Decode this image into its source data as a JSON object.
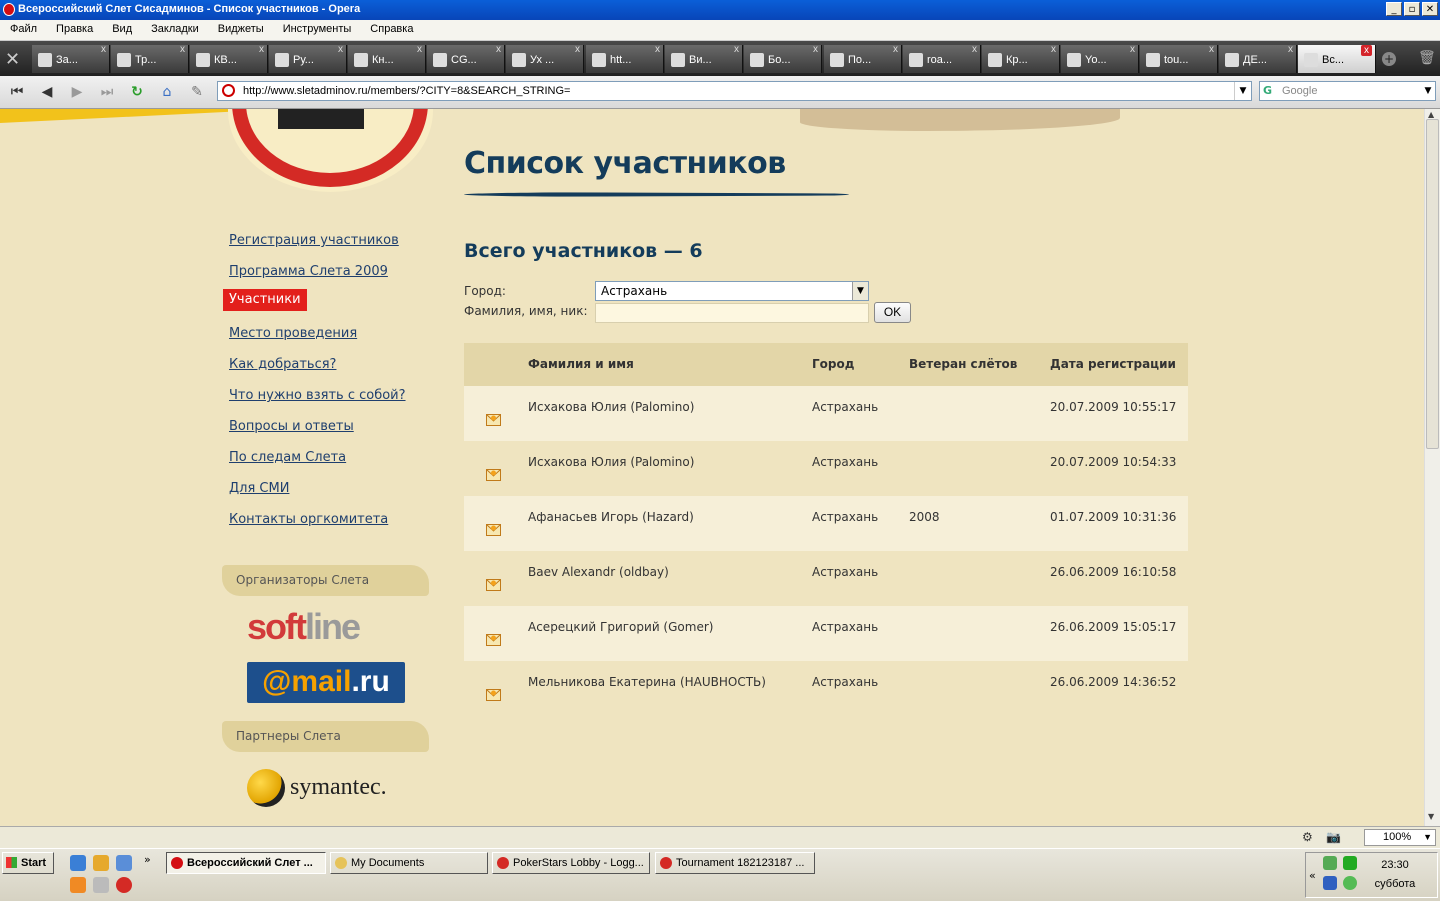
{
  "window": {
    "title": "Всероссийский Слет Сисадминов - Список участников - Opera"
  },
  "menu": [
    "Файл",
    "Правка",
    "Вид",
    "Закладки",
    "Виджеты",
    "Инструменты",
    "Справка"
  ],
  "tabs": [
    {
      "label": "За...",
      "icon": "wrench-icon"
    },
    {
      "label": "Тр...",
      "icon": "percent-icon"
    },
    {
      "label": "КВ...",
      "icon": "globe-icon"
    },
    {
      "label": "Ру...",
      "icon": "heart-icon"
    },
    {
      "label": "Кн...",
      "icon": "heart-icon"
    },
    {
      "label": "CG...",
      "icon": "cube-icon"
    },
    {
      "label": "Ух ...",
      "icon": "link-icon"
    },
    {
      "label": "htt...",
      "icon": "cube-icon"
    },
    {
      "label": "Ви...",
      "icon": "pin-icon"
    },
    {
      "label": "Бо...",
      "icon": "d-icon"
    },
    {
      "label": "По...",
      "icon": "cube-icon"
    },
    {
      "label": "roa...",
      "icon": "percent-icon"
    },
    {
      "label": "Кр...",
      "icon": "figure-icon"
    },
    {
      "label": "Yo...",
      "icon": "youtube-icon"
    },
    {
      "label": "tou...",
      "icon": "bull-icon"
    },
    {
      "label": "ДЕ...",
      "icon": "image-icon"
    },
    {
      "label": "Вс...",
      "icon": "no-sign-icon",
      "active": true
    }
  ],
  "address": {
    "url": "http://www.sletadminov.ru/members/?CITY=8&SEARCH_STRING="
  },
  "search": {
    "placeholder": "Google"
  },
  "page": {
    "heading": "Список участников",
    "total": "Всего участников — 6",
    "filter": {
      "city_label": "Город:",
      "city_value": "Астрахань",
      "name_label": "Фамилия, имя, ник:",
      "name_value": "",
      "ok_label": "OK"
    },
    "table": {
      "headers": [
        "Фамилия и имя",
        "Город",
        "Ветеран слётов",
        "Дата регистрации"
      ],
      "rows": [
        {
          "name": "Исхакова Юлия (Palomino)",
          "city": "Астрахань",
          "veteran": "",
          "date": "20.07.2009 10:55:17"
        },
        {
          "name": "Исхакова Юлия (Palomino)",
          "city": "Астрахань",
          "veteran": "",
          "date": "20.07.2009 10:54:33"
        },
        {
          "name": "Афанасьев Игорь (Hazard)",
          "city": "Астрахань",
          "veteran": "2008",
          "date": "01.07.2009 10:31:36"
        },
        {
          "name": "Baev Alexandr (oldbay)",
          "city": "Астрахань",
          "veteran": "",
          "date": "26.06.2009 16:10:58"
        },
        {
          "name": "Асерецкий Григорий (Gomer)",
          "city": "Астрахань",
          "veteran": "",
          "date": "26.06.2009 15:05:17"
        },
        {
          "name": "Мельникова Екатерина (HAUВНОСТЬ)",
          "city": "Астрахань",
          "veteran": "",
          "date": "26.06.2009 14:36:52"
        }
      ]
    }
  },
  "sidebar": {
    "links": [
      {
        "label": "Регистрация участников"
      },
      {
        "label": "Программа Слета 2009"
      },
      {
        "label": "Участники",
        "active": true
      },
      {
        "label": "Место проведения"
      },
      {
        "label": "Как добраться?"
      },
      {
        "label": "Что нужно взять с собой?"
      },
      {
        "label": "Вопросы и ответы"
      },
      {
        "label": "По следам Слета"
      },
      {
        "label": "Для СМИ"
      },
      {
        "label": "Контакты оргкомитета"
      }
    ],
    "organizers_title": "Организаторы Слета",
    "partners_title": "Партнеры Слета",
    "logos": {
      "softline_a": "soft",
      "softline_b": "line",
      "mailru_a": "@mail",
      "mailru_b": ".ru",
      "symantec": "symantec."
    }
  },
  "status": {
    "zoom": "100%"
  },
  "taskbar": {
    "start": "Start",
    "buttons": [
      {
        "label": "Всероссийский Слет ...",
        "active": true
      },
      {
        "label": "My Documents"
      },
      {
        "label": "PokerStars Lobby - Logg..."
      },
      {
        "label": "Tournament 182123187 ..."
      }
    ],
    "time": "23:30",
    "day": "суббота"
  }
}
